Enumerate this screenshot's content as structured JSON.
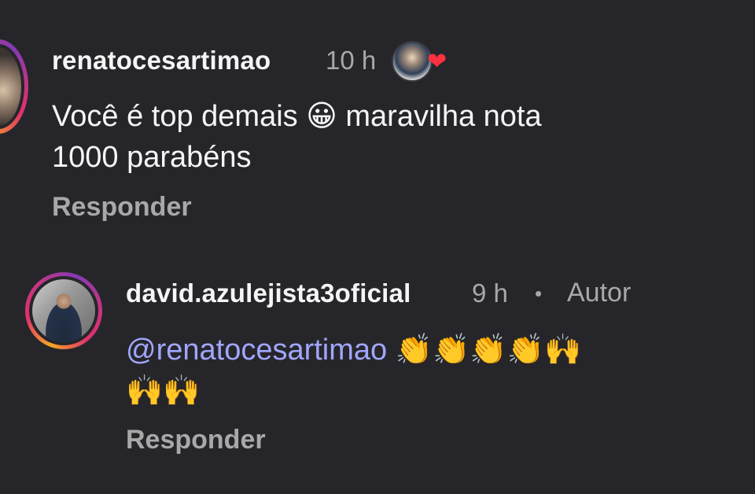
{
  "comment1": {
    "username": "renatocesartimao",
    "time": "10 h",
    "text_line1": "Você é top demais 😀 maravilha nota",
    "text_line2": "1000 parabéns",
    "reply_label": "Responder",
    "heart_icon": "heart-icon",
    "heart_color": "#ff3040"
  },
  "comment2": {
    "username": "david.azulejista3oficial",
    "time": "9 h",
    "separator": "•",
    "author_badge": "Autor",
    "mention": "@renatocesartimao",
    "emojis_line1": "👏👏👏👏🙌",
    "emojis_line2": "🙌🙌",
    "reply_label": "Responder",
    "mention_color": "#a1a6ff"
  },
  "colors": {
    "background": "#26262a",
    "primary_text": "#f5f5f5",
    "secondary_text": "#a8a8a8"
  }
}
